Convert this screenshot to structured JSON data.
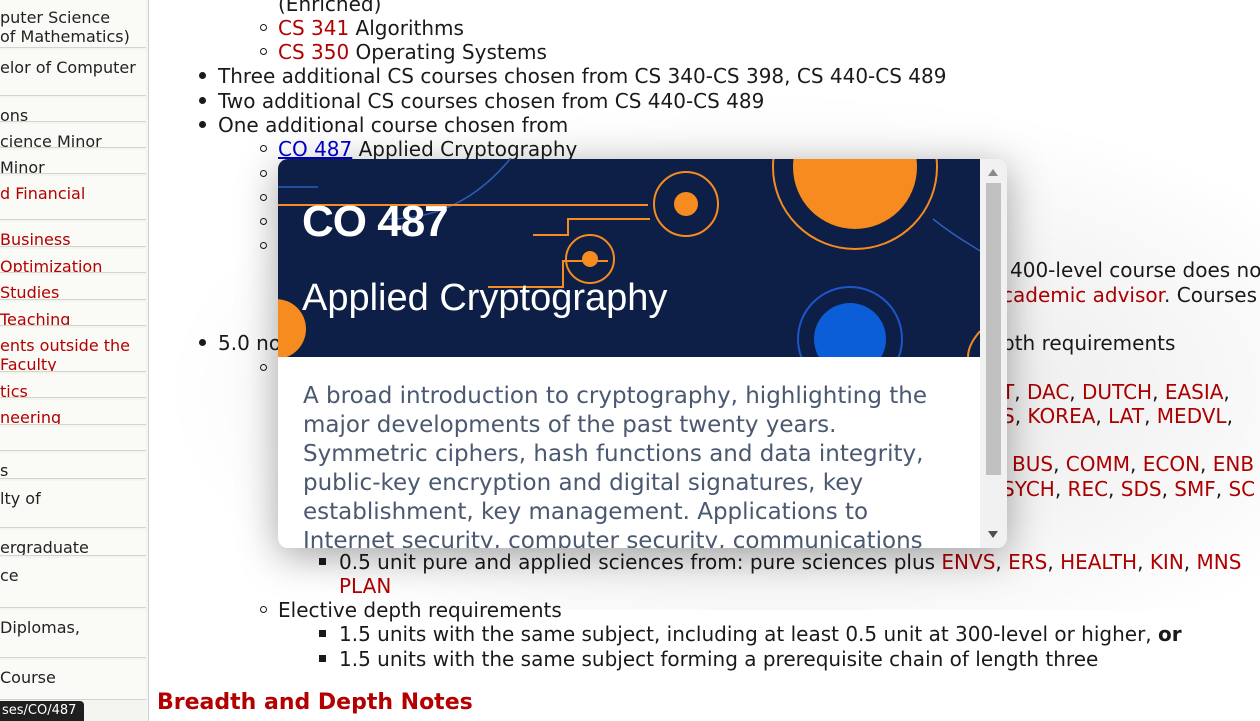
{
  "sidebar": {
    "items": [
      {
        "lines": [
          "puter Science",
          " of Mathematics)"
        ],
        "color": "black"
      },
      {
        "lines": [
          "elor of Computer"
        ],
        "color": "black"
      },
      {
        "lines": [
          "ons"
        ],
        "color": "black"
      },
      {
        "lines": [
          "cience Minor"
        ],
        "color": "black"
      },
      {
        "lines": [
          "Minor"
        ],
        "color": "black"
      },
      {
        "lines": [
          "d Financial"
        ],
        "color": "red"
      },
      {
        "lines": [
          "Business"
        ],
        "color": "red"
      },
      {
        "lines": [
          "Optimization"
        ],
        "color": "red"
      },
      {
        "lines": [
          "Studies"
        ],
        "color": "red"
      },
      {
        "lines": [
          "Teaching"
        ],
        "color": "red"
      },
      {
        "lines": [
          "ents outside the",
          "Faculty"
        ],
        "color": "red"
      },
      {
        "lines": [
          "tics"
        ],
        "color": "red"
      },
      {
        "lines": [
          "neering"
        ],
        "color": "red"
      },
      {
        "lines": [
          ""
        ],
        "color": "black"
      },
      {
        "lines": [
          "s"
        ],
        "color": "black"
      },
      {
        "lines": [
          "lty of"
        ],
        "color": "black"
      },
      {
        "lines": [
          "ergraduate"
        ],
        "color": "black"
      },
      {
        "lines": [
          "ce"
        ],
        "color": "black"
      },
      {
        "lines": [
          " Diplomas,"
        ],
        "color": "black"
      },
      {
        "lines": [
          "Course"
        ],
        "color": "black"
      }
    ]
  },
  "content": {
    "enriched_fragment": "(Enriched)",
    "cs341_code": "CS 341",
    "cs341_name": " Algorithms",
    "cs350_code": "CS 350",
    "cs350_name": " Operating Systems",
    "bullet_three": "Three additional CS courses chosen from CS 340-CS 398, CS 440-CS 489",
    "bullet_two": "Two additional CS courses chosen from CS 440-CS 489",
    "bullet_one": "One additional course chosen from",
    "co487_link": "CO 487",
    "co487_name": " Applied Cryptography",
    "right_400level": "400-level course does no",
    "right_advisor_link": "cademic advisor",
    "right_advisor_tail": ". Courses",
    "bullet_five_start": "5.0 no",
    "right_depth_req": "pth requirements",
    "subj_row1": [
      {
        "text": "T",
        "sep": ", "
      },
      {
        "text": "DAC",
        "sep": ", "
      },
      {
        "text": "DUTCH",
        "sep": ", "
      },
      {
        "text": "EASIA",
        "sep": ","
      }
    ],
    "subj_row2": [
      {
        "text": "S",
        "sep": ", "
      },
      {
        "text": "KOREA",
        "sep": ", "
      },
      {
        "text": "LAT",
        "sep": ", "
      },
      {
        "text": "MEDVL",
        "sep": ","
      }
    ],
    "subj_row3": [
      {
        "text": "BUS",
        "sep": ", "
      },
      {
        "text": "COMM",
        "sep": ", "
      },
      {
        "text": "ECON",
        "sep": ", "
      },
      {
        "text": "ENB",
        "sep": ""
      }
    ],
    "subj_row4": [
      {
        "text": "SYCH",
        "sep": ", "
      },
      {
        "text": "REC",
        "sep": ", "
      },
      {
        "text": "SDS",
        "sep": ", "
      },
      {
        "text": "SMF",
        "sep": ", "
      },
      {
        "text": "SC",
        "sep": ""
      }
    ],
    "pure_applied_prefix": "0.5 unit pure and applied sciences from: pure sciences plus ",
    "pure_applied_subjects": [
      {
        "text": "ENVS",
        "sep": ", "
      },
      {
        "text": "ERS",
        "sep": ", "
      },
      {
        "text": "HEALTH",
        "sep": ", "
      },
      {
        "text": "KIN",
        "sep": ", "
      },
      {
        "text": "MNS",
        "sep": ""
      }
    ],
    "plan_link": "PLAN",
    "elective_depth": "Elective depth requirements",
    "depth_a_text": "1.5 units with the same subject, including at least 0.5 unit at 300-level or higher, ",
    "depth_a_or": "or",
    "depth_b_text": "1.5 units with the same subject forming a prerequisite chain of length three",
    "section_heading": "Breadth and Depth Notes"
  },
  "modal": {
    "course_code": "CO 487",
    "course_title": "Applied Cryptography",
    "description": "A broad introduction to cryptography, highlighting the major developments of the past twenty years. Symmetric ciphers, hash functions and data integrity, public-key encryption and digital signatures, key establishment, key management. Applications to Internet security, computer security, communications",
    "colors": {
      "banner_bg": "#0d1f46",
      "accent_orange": "#f68b1f",
      "accent_blue": "#0b5ed7"
    }
  },
  "statusbar": {
    "url_fragment": "ses/CO/487"
  },
  "colors": {
    "link_red": "#b30000",
    "link_blue": "#0000cc"
  }
}
